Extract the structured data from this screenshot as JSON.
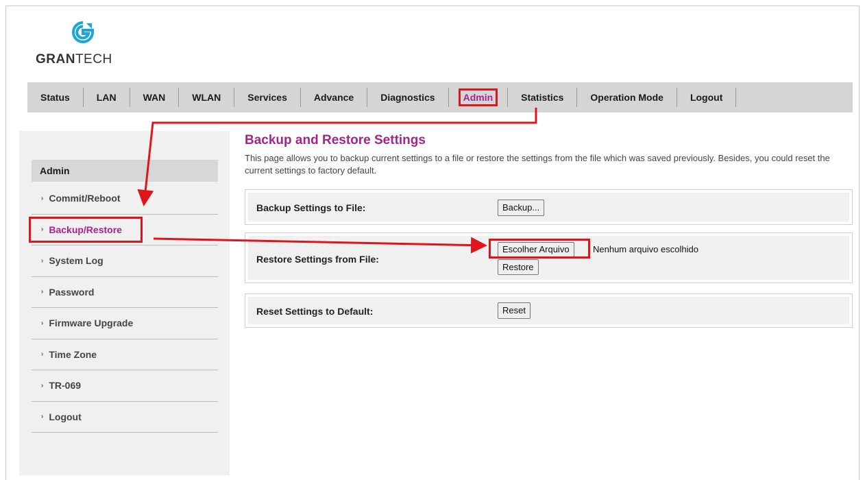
{
  "brand": {
    "name_bold": "GRAN",
    "name_rest": "TECH",
    "accent": "#a6228d",
    "highlight": "#e0141b"
  },
  "nav": {
    "items": [
      {
        "label": "Status"
      },
      {
        "label": "LAN"
      },
      {
        "label": "WAN"
      },
      {
        "label": "WLAN"
      },
      {
        "label": "Services"
      },
      {
        "label": "Advance"
      },
      {
        "label": "Diagnostics"
      },
      {
        "label": "Admin",
        "active": true
      },
      {
        "label": "Statistics"
      },
      {
        "label": "Operation Mode"
      },
      {
        "label": "Logout"
      }
    ]
  },
  "sidebar": {
    "heading": "Admin",
    "items": [
      {
        "label": "Commit/Reboot"
      },
      {
        "label": "Backup/Restore",
        "active": true
      },
      {
        "label": "System Log"
      },
      {
        "label": "Password"
      },
      {
        "label": "Firmware Upgrade"
      },
      {
        "label": "Time Zone"
      },
      {
        "label": "TR-069"
      },
      {
        "label": "Logout"
      }
    ]
  },
  "main": {
    "title": "Backup and Restore Settings",
    "description": "This page allows you to backup current settings to a file or restore the settings from the file which was saved previously. Besides, you could reset the current settings to factory default.",
    "backup": {
      "label": "Backup Settings to File:",
      "button": "Backup..."
    },
    "restore": {
      "label": "Restore Settings from File:",
      "choose_button": "Escolher Arquivo",
      "file_status": "Nenhum arquivo escolhido",
      "restore_button": "Restore"
    },
    "reset": {
      "label": "Reset Settings to Default:",
      "button": "Reset"
    }
  },
  "icons": {
    "logo": "grantech-logo-icon",
    "bullet": "chevron-right-icon"
  }
}
